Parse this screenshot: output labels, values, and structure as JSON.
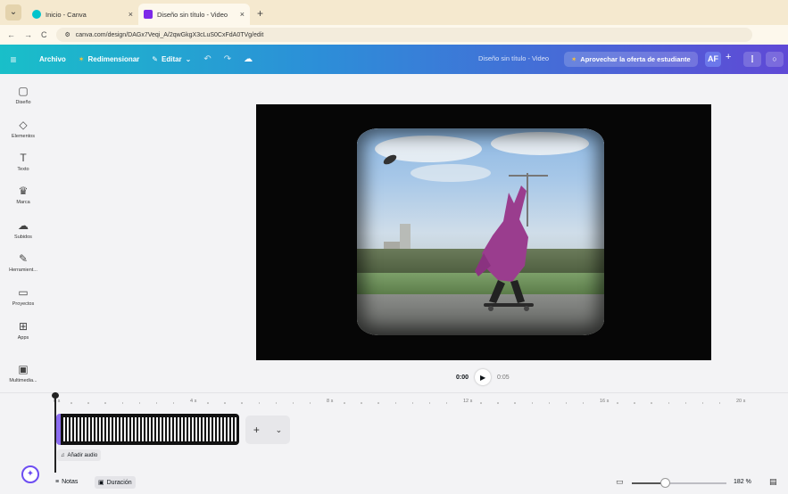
{
  "browser": {
    "tabs": [
      {
        "title": "Inicio - Canva",
        "close": "×",
        "favicon_color": "#00c4cc"
      },
      {
        "title": "Diseño sin título - Video",
        "close": "×",
        "favicon_color": "#7d2ae8"
      }
    ],
    "new_tab": "+",
    "menu_glyph": "⌄",
    "url": "canva.com/design/DAGx7Veqi_A/2qwGkgX3cLuS0CxFdA0TVg/edit",
    "nav": {
      "back": "←",
      "forward": "→",
      "reload": "C"
    }
  },
  "header": {
    "menu_glyph": "≡",
    "archivo": "Archivo",
    "redimensionar": "Redimensionar",
    "editar": "Editar",
    "editar_chevron": "⌄",
    "undo": "↶",
    "redo": "↷",
    "cloud": "☁",
    "doc_title": "Diseño sin título - Video",
    "offer": "Aprovechar la oferta de estudiante",
    "avatar": "AF",
    "plus": "+",
    "stats_glyph": "⫿",
    "comment_glyph": "○"
  },
  "sidebar": {
    "items": [
      {
        "icon": "design-icon",
        "glyph": "▢",
        "label": "Diseño"
      },
      {
        "icon": "elements-icon",
        "glyph": "◇",
        "label": "Elementos"
      },
      {
        "icon": "text-icon",
        "glyph": "T",
        "label": "Texto"
      },
      {
        "icon": "brand-icon",
        "glyph": "♛",
        "label": "Marca"
      },
      {
        "icon": "uploads-icon",
        "glyph": "☁",
        "label": "Subidos"
      },
      {
        "icon": "tools-icon",
        "glyph": "✎",
        "label": "Herramient..."
      },
      {
        "icon": "projects-icon",
        "glyph": "▭",
        "label": "Proyectos"
      },
      {
        "icon": "apps-icon",
        "glyph": "⊞",
        "label": "Apps"
      },
      {
        "icon": "media-icon",
        "glyph": "▣",
        "label": "Multimedia..."
      }
    ]
  },
  "player": {
    "current": "0:00",
    "play_glyph": "▶",
    "total": "0:05"
  },
  "timeline": {
    "ruler": [
      "0 s",
      "4 s",
      "8 s",
      "12 s",
      "16 s",
      "20 s"
    ],
    "add_glyph": "+",
    "more_glyph": "⌄",
    "add_audio": "Añadir audio",
    "audio_glyph": "♫"
  },
  "bottom": {
    "notes": "Notas",
    "notes_glyph": "≡",
    "duration": "Duración",
    "duration_glyph": "▣",
    "zoom": "182 %",
    "pages_glyph": "▭",
    "fullscreen_glyph": "▤",
    "zoom_level": 0.35
  }
}
